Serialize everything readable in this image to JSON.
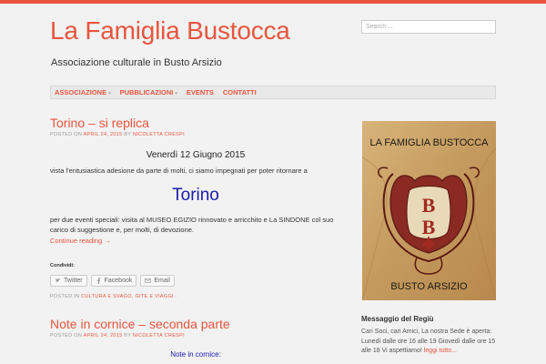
{
  "site": {
    "title": "La Famiglia Bustocca",
    "tagline": "Associazione culturale in Busto Arsizio",
    "search_placeholder": "Search ..."
  },
  "nav": {
    "items": [
      {
        "label": "ASSOCIAZIONE",
        "has_submenu": true
      },
      {
        "label": "PUBBLICAZIONI",
        "has_submenu": true
      },
      {
        "label": "EVENTS",
        "has_submenu": false
      },
      {
        "label": "CONTATTI",
        "has_submenu": false
      }
    ],
    "submenu_arrow": "▾"
  },
  "post1": {
    "title": "Torino – si replica",
    "meta_posted": "POSTED ON",
    "meta_date": "APRIL 24, 2015",
    "meta_by": "BY",
    "meta_author": "NICOLETTA CRESPI",
    "date_line": "Venerdì 12 Giugno 2015",
    "intro": "vista l'entusiastica adesione da parte di molti, ci siamo impegnati per poter ritornare a",
    "city": "Torino",
    "body": "per due eventi speciali: visita al MUSEO EGIZIO rinnovato e arricchito e La SINDONE col suo carico di suggestione e, per molti, di devozione.",
    "continue": "Continue reading →",
    "share_label": "Condividi:",
    "share_buttons": [
      {
        "label": "Twitter",
        "icon": "twitter-icon"
      },
      {
        "label": "Facebook",
        "icon": "facebook-icon"
      },
      {
        "label": "Email",
        "icon": "email-icon"
      }
    ],
    "posted_in": "POSTED IN",
    "category": "CULTURA E SVAGO, GITE E VIAGGI",
    "sep": "·"
  },
  "post2": {
    "title": "Note in cornice – seconda parte",
    "meta_posted": "POSTED ON",
    "meta_date": "APRIL 24, 2015",
    "meta_by": "BY",
    "meta_author": "NICOLETTA CRESPI",
    "first_line": "Note in cornice:"
  },
  "sidebar": {
    "banner": {
      "top_text": "LA FAMIGLIA BUSTOCCA",
      "monogram_top": "B",
      "monogram_bottom": "B",
      "bottom_text": "BUSTO ARSIZIO"
    },
    "widget_title": "Messaggio del Regiù",
    "widget_text": "Cari Soci, cari Amici, La nostra Sede è aperta: Lunedì dalle ore 16 alle 19 Giovedì dalle ore 15 alle 18 Vi aspettiamo!",
    "widget_link": "leggi tutto..."
  },
  "colors": {
    "accent": "#e8553e",
    "background": "#f2f2f2",
    "city_blue": "#1a1aaa",
    "banner_gold": "#c9a066"
  }
}
